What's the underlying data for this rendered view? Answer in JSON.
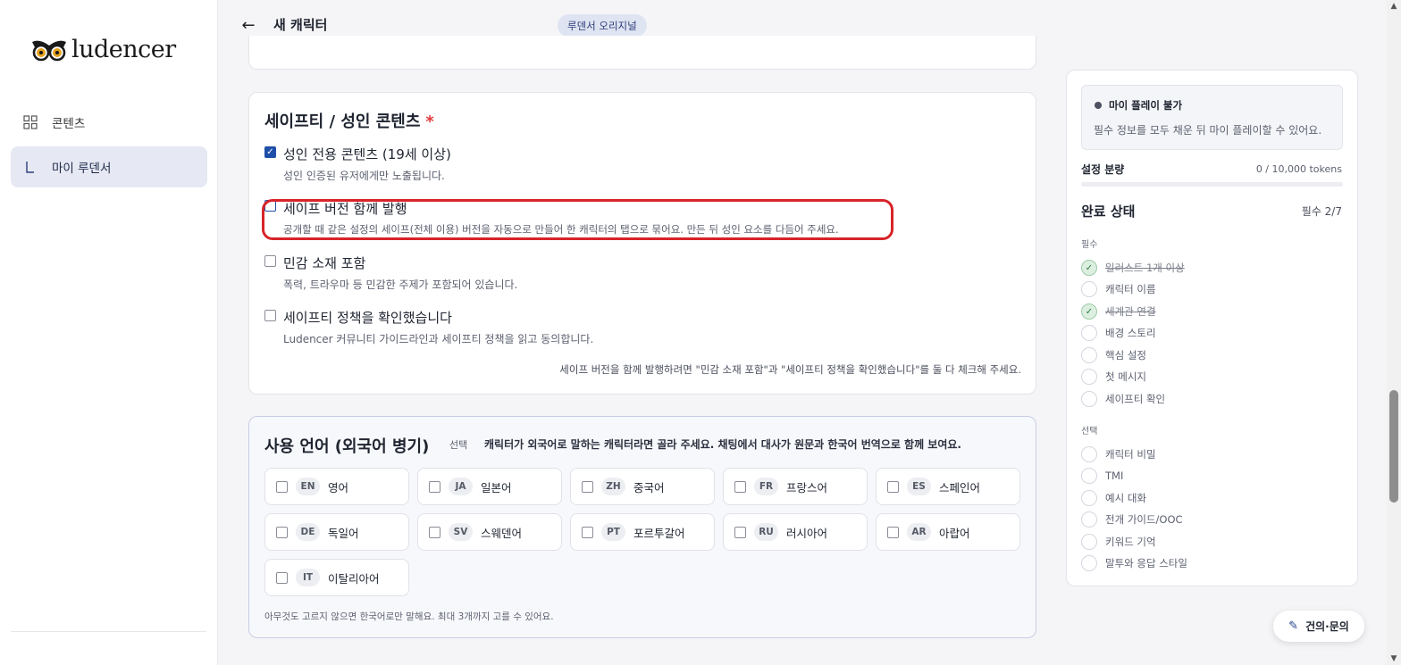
{
  "sidebar": {
    "logo_text": "ludencer",
    "items": [
      {
        "label": "콘텐츠",
        "icon": "grid-icon"
      },
      {
        "label": "마이 루덴서",
        "icon": "corner-bracket-icon"
      }
    ]
  },
  "header": {
    "back_icon": "arrow-left-icon",
    "title": "새 캐릭터",
    "badge": "루덴서 오리지널"
  },
  "safety": {
    "title": "세이프티 / 성인 콘텐츠",
    "required_mark": "*",
    "options": [
      {
        "label": "성인 전용 콘텐츠 (19세 이상)",
        "desc": "성인 인증된 유저에게만 노출됩니다.",
        "checked": true
      },
      {
        "label": "세이프 버전 함께 발행",
        "desc": "공개할 때 같은 설정의 세이프(전체 이용) 버전을 자동으로 만들어 한 캐릭터의 탭으로 묶어요. 만든 뒤 성인 요소를 다듬어 주세요.",
        "checked": false
      },
      {
        "label": "민감 소재 포함",
        "desc": "폭력, 트라우마 등 민감한 주제가 포함되어 있습니다.",
        "checked": false
      },
      {
        "label": "세이프티 정책을 확인했습니다",
        "desc": "Ludencer 커뮤니티 가이드라인과 세이프티 정책을 읽고 동의합니다.",
        "checked": false
      }
    ],
    "note": "세이프 버전을 함께 발행하려면 \"민감 소재 포함\"과 \"세이프티 정책을 확인했습니다\"를 둘 다 체크해 주세요."
  },
  "language": {
    "title": "사용 언어 (외국어 병기)",
    "optional_tag": "선택",
    "hint": "캐릭터가 외국어로 말하는 캐릭터라면 골라 주세요. 채팅에서 대사가 원문과 한국어 번역으로 함께 보여요.",
    "options": [
      {
        "code": "EN",
        "name": "영어"
      },
      {
        "code": "JA",
        "name": "일본어"
      },
      {
        "code": "ZH",
        "name": "중국어"
      },
      {
        "code": "FR",
        "name": "프랑스어"
      },
      {
        "code": "ES",
        "name": "스페인어"
      },
      {
        "code": "DE",
        "name": "독일어"
      },
      {
        "code": "SV",
        "name": "스웨덴어"
      },
      {
        "code": "PT",
        "name": "포르투갈어"
      },
      {
        "code": "RU",
        "name": "러시아어"
      },
      {
        "code": "AR",
        "name": "아랍어"
      },
      {
        "code": "IT",
        "name": "이탈리아어"
      }
    ],
    "footer": "아무것도 고르지 않으면 한국어로만 말해요. 최대 3개까지 고를 수 있어요."
  },
  "panel": {
    "status_title": "마이 플레이 불가",
    "status_desc": "필수 정보를 모두 채운 뒤 마이 플레이할 수 있어요.",
    "amount_label": "설정 분량",
    "amount_value": "0 / 10,000 tokens",
    "amount_fraction": 0,
    "done_title": "완료 상태",
    "done_count": "필수 2/7",
    "required_label": "필수",
    "required": [
      {
        "label": "일러스트 1개 이상",
        "done": true
      },
      {
        "label": "캐릭터 이름",
        "done": false
      },
      {
        "label": "세계관 연결",
        "done": true
      },
      {
        "label": "배경 스토리",
        "done": false
      },
      {
        "label": "핵심 설정",
        "done": false
      },
      {
        "label": "첫 메시지",
        "done": false
      },
      {
        "label": "세이프티 확인",
        "done": false
      }
    ],
    "optional_label": "선택",
    "optional": [
      {
        "label": "캐릭터 비밀"
      },
      {
        "label": "TMI"
      },
      {
        "label": "예시 대화"
      },
      {
        "label": "전개 가이드/OOC"
      },
      {
        "label": "키워드 기억"
      },
      {
        "label": "말투와 응답 스타일"
      }
    ]
  },
  "faq_button": "건의·문의",
  "colors": {
    "accent": "#1f4fa8",
    "badge_bg": "#dfe4f2",
    "highlight": "#d8242a",
    "done_green": "#2c7a3f"
  }
}
